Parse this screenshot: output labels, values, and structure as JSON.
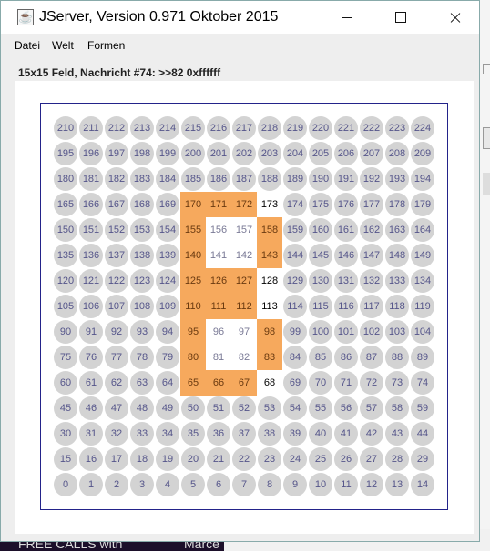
{
  "window": {
    "title": "JServer, Version 0.971 Oktober 2015",
    "app_icon": "java-cup-icon"
  },
  "menu": [
    "Datei",
    "Welt",
    "Formen"
  ],
  "status": "15x15 Feld, Nachricht #74: >>82 0xffffff",
  "grid": {
    "size": 15,
    "cell_color_default": "#d3d3d3",
    "orange_color": "#f6a95d",
    "orange_cells": [
      65,
      66,
      67,
      80,
      83,
      95,
      98,
      110,
      111,
      112,
      125,
      126,
      127,
      140,
      143,
      155,
      158,
      170,
      171,
      172
    ],
    "white_cells": [
      81,
      82,
      96,
      97,
      141,
      142,
      156,
      157
    ],
    "edge_cells": [
      68,
      113,
      128,
      173
    ]
  },
  "background": {
    "text_left": "FREE CALLS with",
    "text_right": "Marce"
  }
}
